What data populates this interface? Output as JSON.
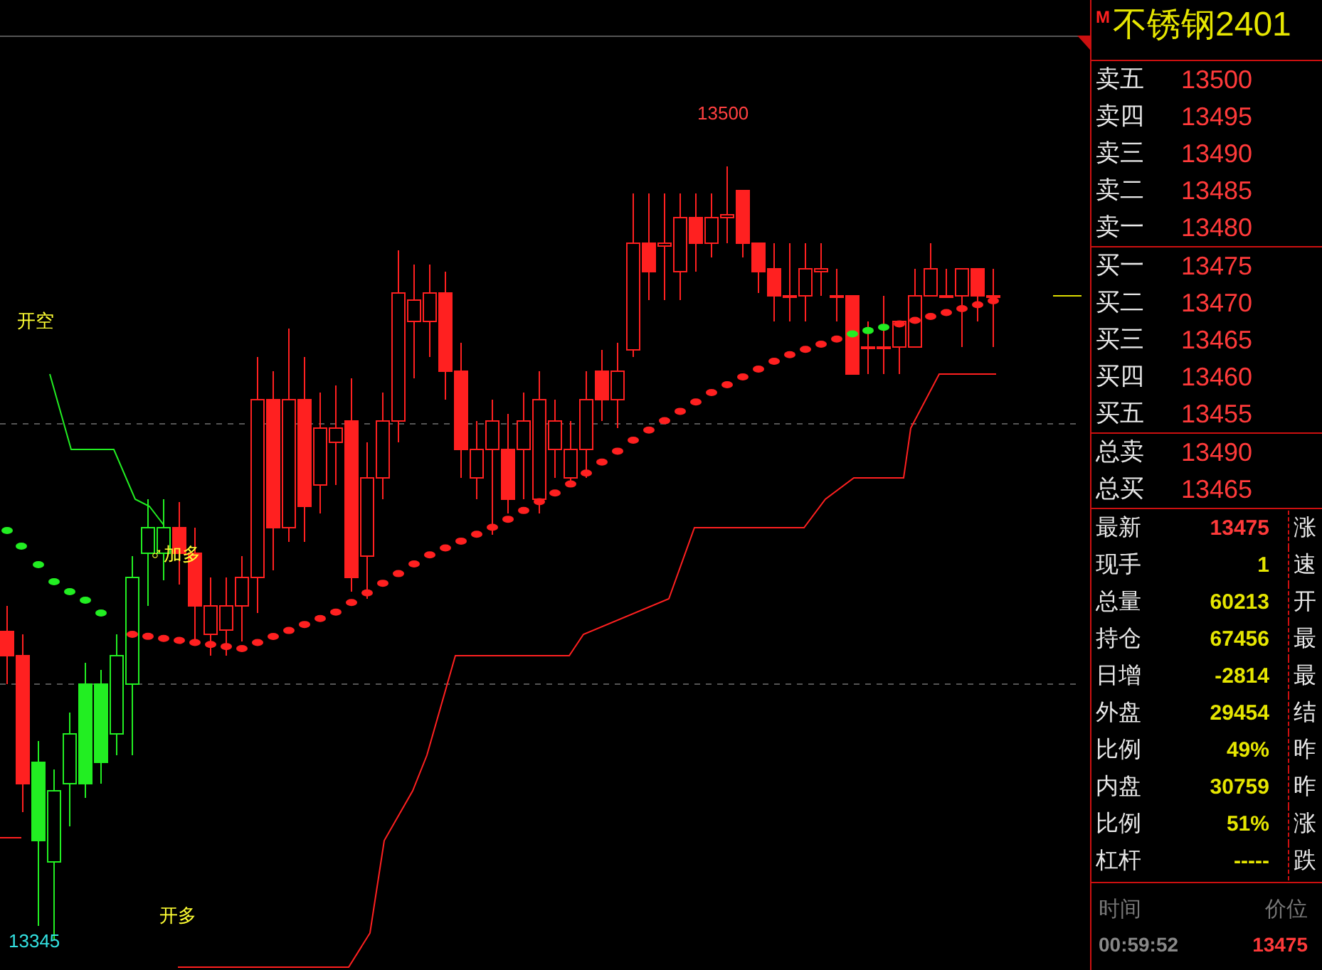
{
  "title_bar": {
    "badge": "M",
    "symbol": "不锈钢2401"
  },
  "chart": {
    "labels": [
      {
        "kind": "high",
        "text": "13500"
      },
      {
        "kind": "low",
        "text": "13345"
      },
      {
        "kind": "signal",
        "text": "开空"
      },
      {
        "kind": "signal",
        "text": "♂加多"
      },
      {
        "kind": "signal",
        "text": "开多"
      }
    ]
  },
  "order_book": {
    "asks": [
      {
        "label": "卖五",
        "price": "13500"
      },
      {
        "label": "卖四",
        "price": "13495"
      },
      {
        "label": "卖三",
        "price": "13490"
      },
      {
        "label": "卖二",
        "price": "13485"
      },
      {
        "label": "卖一",
        "price": "13480"
      }
    ],
    "bids": [
      {
        "label": "买一",
        "price": "13475"
      },
      {
        "label": "买二",
        "price": "13470"
      },
      {
        "label": "买三",
        "price": "13465"
      },
      {
        "label": "买四",
        "price": "13460"
      },
      {
        "label": "买五",
        "price": "13455"
      }
    ],
    "totals": [
      {
        "label": "总卖",
        "price": "13490"
      },
      {
        "label": "总买",
        "price": "13465"
      }
    ]
  },
  "quote": [
    {
      "label": "最新",
      "value": "13475",
      "kind": "price",
      "side_label": "涨"
    },
    {
      "label": "现手",
      "value": "1",
      "kind": "volume",
      "side_label": "速"
    },
    {
      "label": "总量",
      "value": "60213",
      "kind": "volume",
      "side_label": "开"
    },
    {
      "label": "持仓",
      "value": "67456",
      "kind": "volume",
      "side_label": "最"
    },
    {
      "label": "日增",
      "value": "-2814",
      "kind": "volume",
      "side_label": "最"
    },
    {
      "label": "外盘",
      "value": "29454",
      "kind": "volume",
      "side_label": "结"
    },
    {
      "label": "比例",
      "value": "49%",
      "kind": "volume",
      "side_label": "昨"
    },
    {
      "label": "内盘",
      "value": "30759",
      "kind": "volume",
      "side_label": "昨"
    },
    {
      "label": "比例",
      "value": "51%",
      "kind": "volume",
      "side_label": "涨"
    },
    {
      "label": "杠杆",
      "value": "-----",
      "kind": "volume",
      "side_label": "跌"
    }
  ],
  "ticks": {
    "columns": [
      "时间",
      "价位"
    ],
    "rows": [
      {
        "time": "00:59:52",
        "price": "13475"
      }
    ]
  }
}
